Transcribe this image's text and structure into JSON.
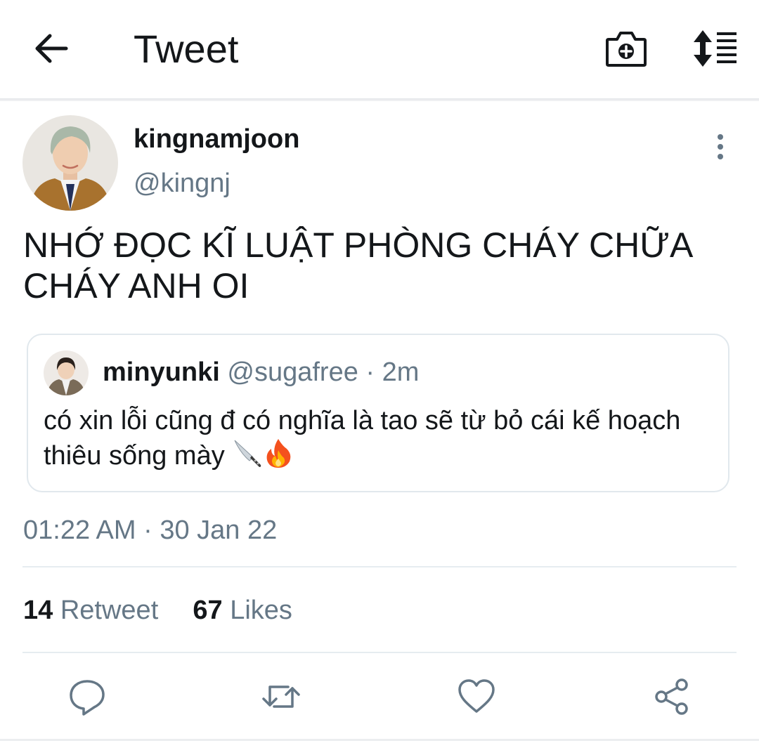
{
  "header": {
    "title": "Tweet",
    "back_icon": "arrow-left-icon",
    "camera_icon": "camera-plus-icon",
    "sort_icon": "sort-list-icon"
  },
  "tweet": {
    "author": {
      "display_name": "kingnamjoon",
      "handle": "@kingnj",
      "avatar_icon": "user-avatar"
    },
    "text": "NHỚ ĐỌC KĨ LUẬT PHÒNG CHÁY CHỮA CHÁY ANH OI",
    "quoted": {
      "display_name": "minyunki",
      "handle": "@sugafree",
      "separator": "·",
      "time": "2m",
      "text": "có xin lỗi cũng đ có nghĩa là tao sẽ từ bỏ cái kế hoạch thiêu sống mày",
      "emoji": [
        "knife-emoji",
        "fire-emoji"
      ]
    },
    "timestamp": "01:22 AM · 30 Jan 22",
    "stats": {
      "retweets_count": "14",
      "retweets_label": "Retweet",
      "likes_count": "67",
      "likes_label": "Likes"
    }
  },
  "actions": {
    "reply_icon": "reply-icon",
    "retweet_icon": "retweet-icon",
    "like_icon": "heart-icon",
    "share_icon": "share-icon"
  },
  "colors": {
    "text_primary": "#14171a",
    "text_secondary": "#657786",
    "border": "#e1e8ed",
    "icon": "#657786"
  }
}
